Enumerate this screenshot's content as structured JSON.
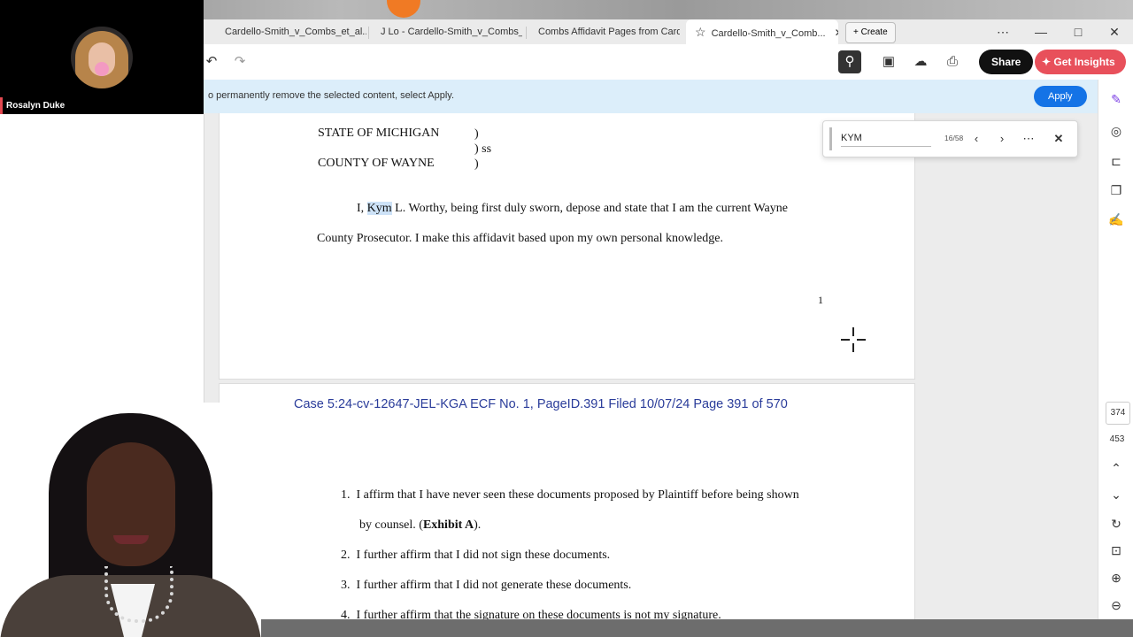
{
  "participants": {
    "top": {
      "name": "Rosalyn Duke"
    }
  },
  "tabs": [
    {
      "label": "Cardello-Smith_v_Combs_et_al..."
    },
    {
      "label": "J Lo - Cardello-Smith_v_Combs_..."
    },
    {
      "label": "Combs Affidavit Pages from Card..."
    },
    {
      "label": "Cardello-Smith_v_Comb..."
    }
  ],
  "tabbar": {
    "create_label": "Create",
    "more": "⋯",
    "minimize": "—",
    "maximize": "□",
    "close": "✕"
  },
  "toolbar": {
    "share_label": "Share",
    "insights_label": "Get Insights"
  },
  "infobar": {
    "text": "o permanently remove the selected content, select Apply.",
    "apply_label": "Apply"
  },
  "find": {
    "query": "KYM",
    "count": "16/58"
  },
  "page1": {
    "state_line": "STATE OF MICHIGAN",
    "paren1": ")",
    "ss": ") ss",
    "county_line": "COUNTY OF WAYNE",
    "paren2": ")",
    "para_prefix": "I, ",
    "para_highlight": "Kym",
    "para_rest": " L. Worthy, being first duly sworn, depose and state that I am the current Wayne",
    "para_line2": "County Prosecutor. I make this affidavit based upon my own personal knowledge.",
    "page_number": "1"
  },
  "page2": {
    "case_header": "Case 5:24-cv-12647-JEL-KGA   ECF No. 1, PageID.391   Filed 10/07/24   Page 391 of 570",
    "items": [
      {
        "num": "1.",
        "text": "I affirm that I have never seen these documents proposed by Plaintiff before being shown",
        "cont_prefix": "by counsel. (",
        "cont_bold": "Exhibit A",
        "cont_suffix": ")."
      },
      {
        "num": "2.",
        "text": "I further affirm that I did not sign these documents."
      },
      {
        "num": "3.",
        "text": "I further affirm that I did not generate these documents."
      },
      {
        "num": "4.",
        "text": "I further affirm that the signature on these documents is not my signature."
      }
    ]
  },
  "rail": {
    "page_current": "374",
    "page_total": "453"
  },
  "colors": {
    "accent": "#1473e6",
    "insights": "#e8505b",
    "header_blue": "#2a3c9a",
    "infobar": "#dceefa"
  }
}
